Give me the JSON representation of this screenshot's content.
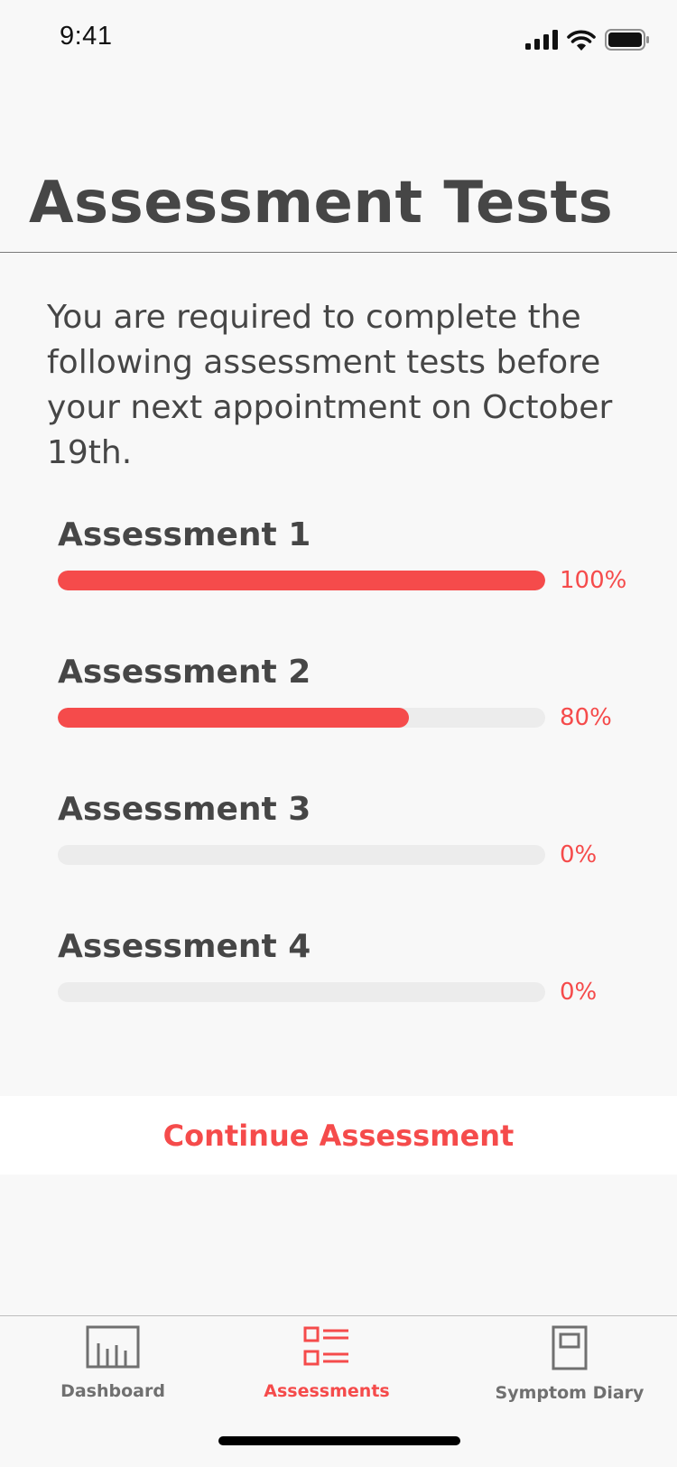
{
  "status_bar": {
    "time": "9:41",
    "icons": [
      "cellular-signal-icon",
      "wifi-icon",
      "battery-icon"
    ]
  },
  "page": {
    "title": "Assessment Tests",
    "intro": "You are required to complete the following assessment tests before your next appointment on October 19th."
  },
  "assessments": [
    {
      "name": "Assessment 1",
      "percent_label": "100%",
      "progress": 100
    },
    {
      "name": "Assessment 2",
      "percent_label": "80%",
      "progress": 72
    },
    {
      "name": "Assessment 3",
      "percent_label": "0%",
      "progress": 0
    },
    {
      "name": "Assessment 4",
      "percent_label": "0%",
      "progress": 0
    }
  ],
  "continue_button": {
    "label": "Continue Assessment"
  },
  "tab_bar": {
    "tabs": [
      {
        "label": "Dashboard",
        "icon": "bar-chart-icon",
        "active": false
      },
      {
        "label": "Assessments",
        "icon": "checklist-icon",
        "active": true
      },
      {
        "label": "Symptom Diary",
        "icon": "book-icon",
        "active": false
      }
    ]
  },
  "colors": {
    "accent": "#f54b4b",
    "text": "#464646",
    "track": "#ececec",
    "background": "#f8f8f8"
  }
}
